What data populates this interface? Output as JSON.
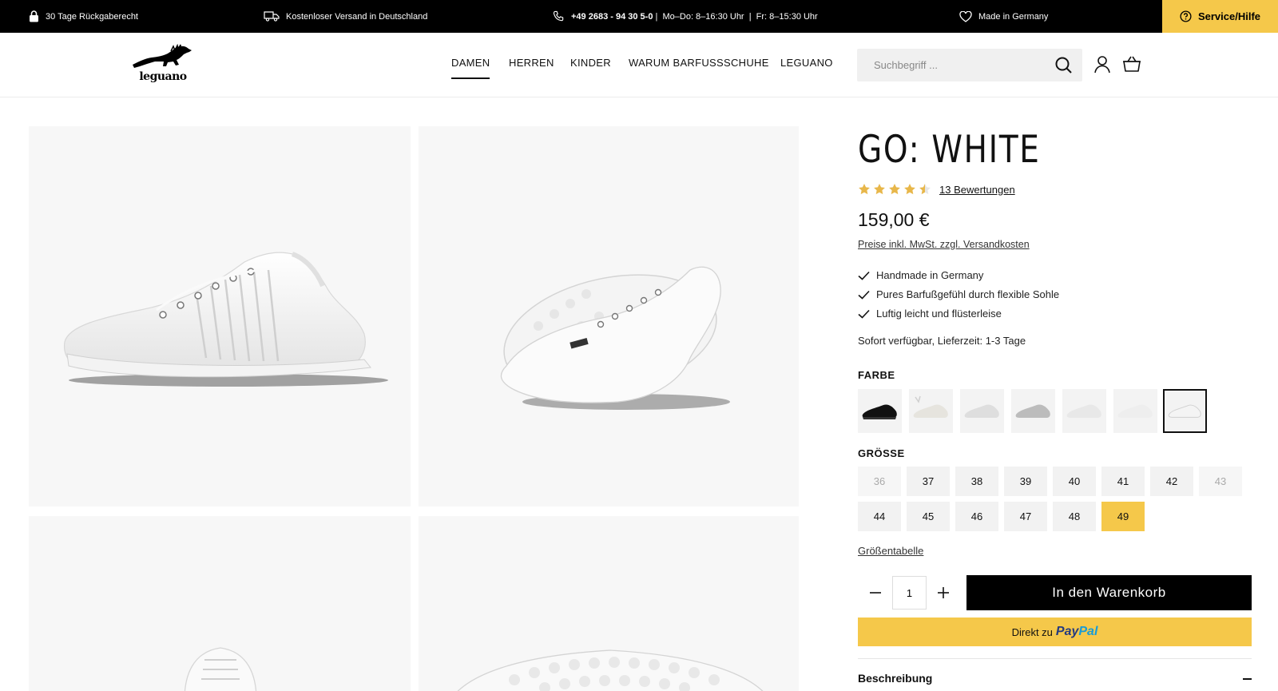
{
  "topbar": {
    "returns": "30 Tage Rückgaberecht",
    "shipping": "Kostenloser Versand in Deutschland",
    "phone": "+49 2683 - 94 30 5-0",
    "hours": " |  Mo–Do: 8–16:30 Uhr  |  Fr: 8–15:30 Uhr",
    "made_in": "Made in Germany",
    "service": "Service/Hilfe"
  },
  "header": {
    "logo": "leguano",
    "nav": [
      "DAMEN",
      "HERREN",
      "KINDER",
      "WARUM BARFUSSSCHUHE",
      "LEGUANO"
    ],
    "active_nav": "DAMEN",
    "search_placeholder": "Suchbegriff ..."
  },
  "product": {
    "title": "GO: WHITE",
    "rating": 4.5,
    "reviews": "13 Bewertungen",
    "price": "159,00 €",
    "tax_note": "Preise inkl. MwSt. zzgl. Versandkosten",
    "features": [
      "Handmade in Germany",
      "Pures Barfußgefühl durch flexible Sohle",
      "Luftig leicht und flüsterleise"
    ],
    "availability": "Sofort verfügbar, Lieferzeit: 1-3 Tage",
    "color_label": "FARBE",
    "size_label": "GRÖSSE",
    "sizes": [
      "36",
      "37",
      "38",
      "39",
      "40",
      "41",
      "42",
      "43",
      "44",
      "45",
      "46",
      "47",
      "48",
      "49"
    ],
    "disabled_sizes": [
      "36",
      "43"
    ],
    "selected_size": "49",
    "size_table": "Größentabelle",
    "quantity": "1",
    "add_to_cart": "In den Warenkorb",
    "paypal_prefix": "Direkt zu",
    "paypal_brand_1": "Pay",
    "paypal_brand_2": "Pal",
    "description": "Beschreibung"
  },
  "colors": {
    "accent": "#f5c84a",
    "black": "#000000",
    "star": "#e8b74a"
  }
}
